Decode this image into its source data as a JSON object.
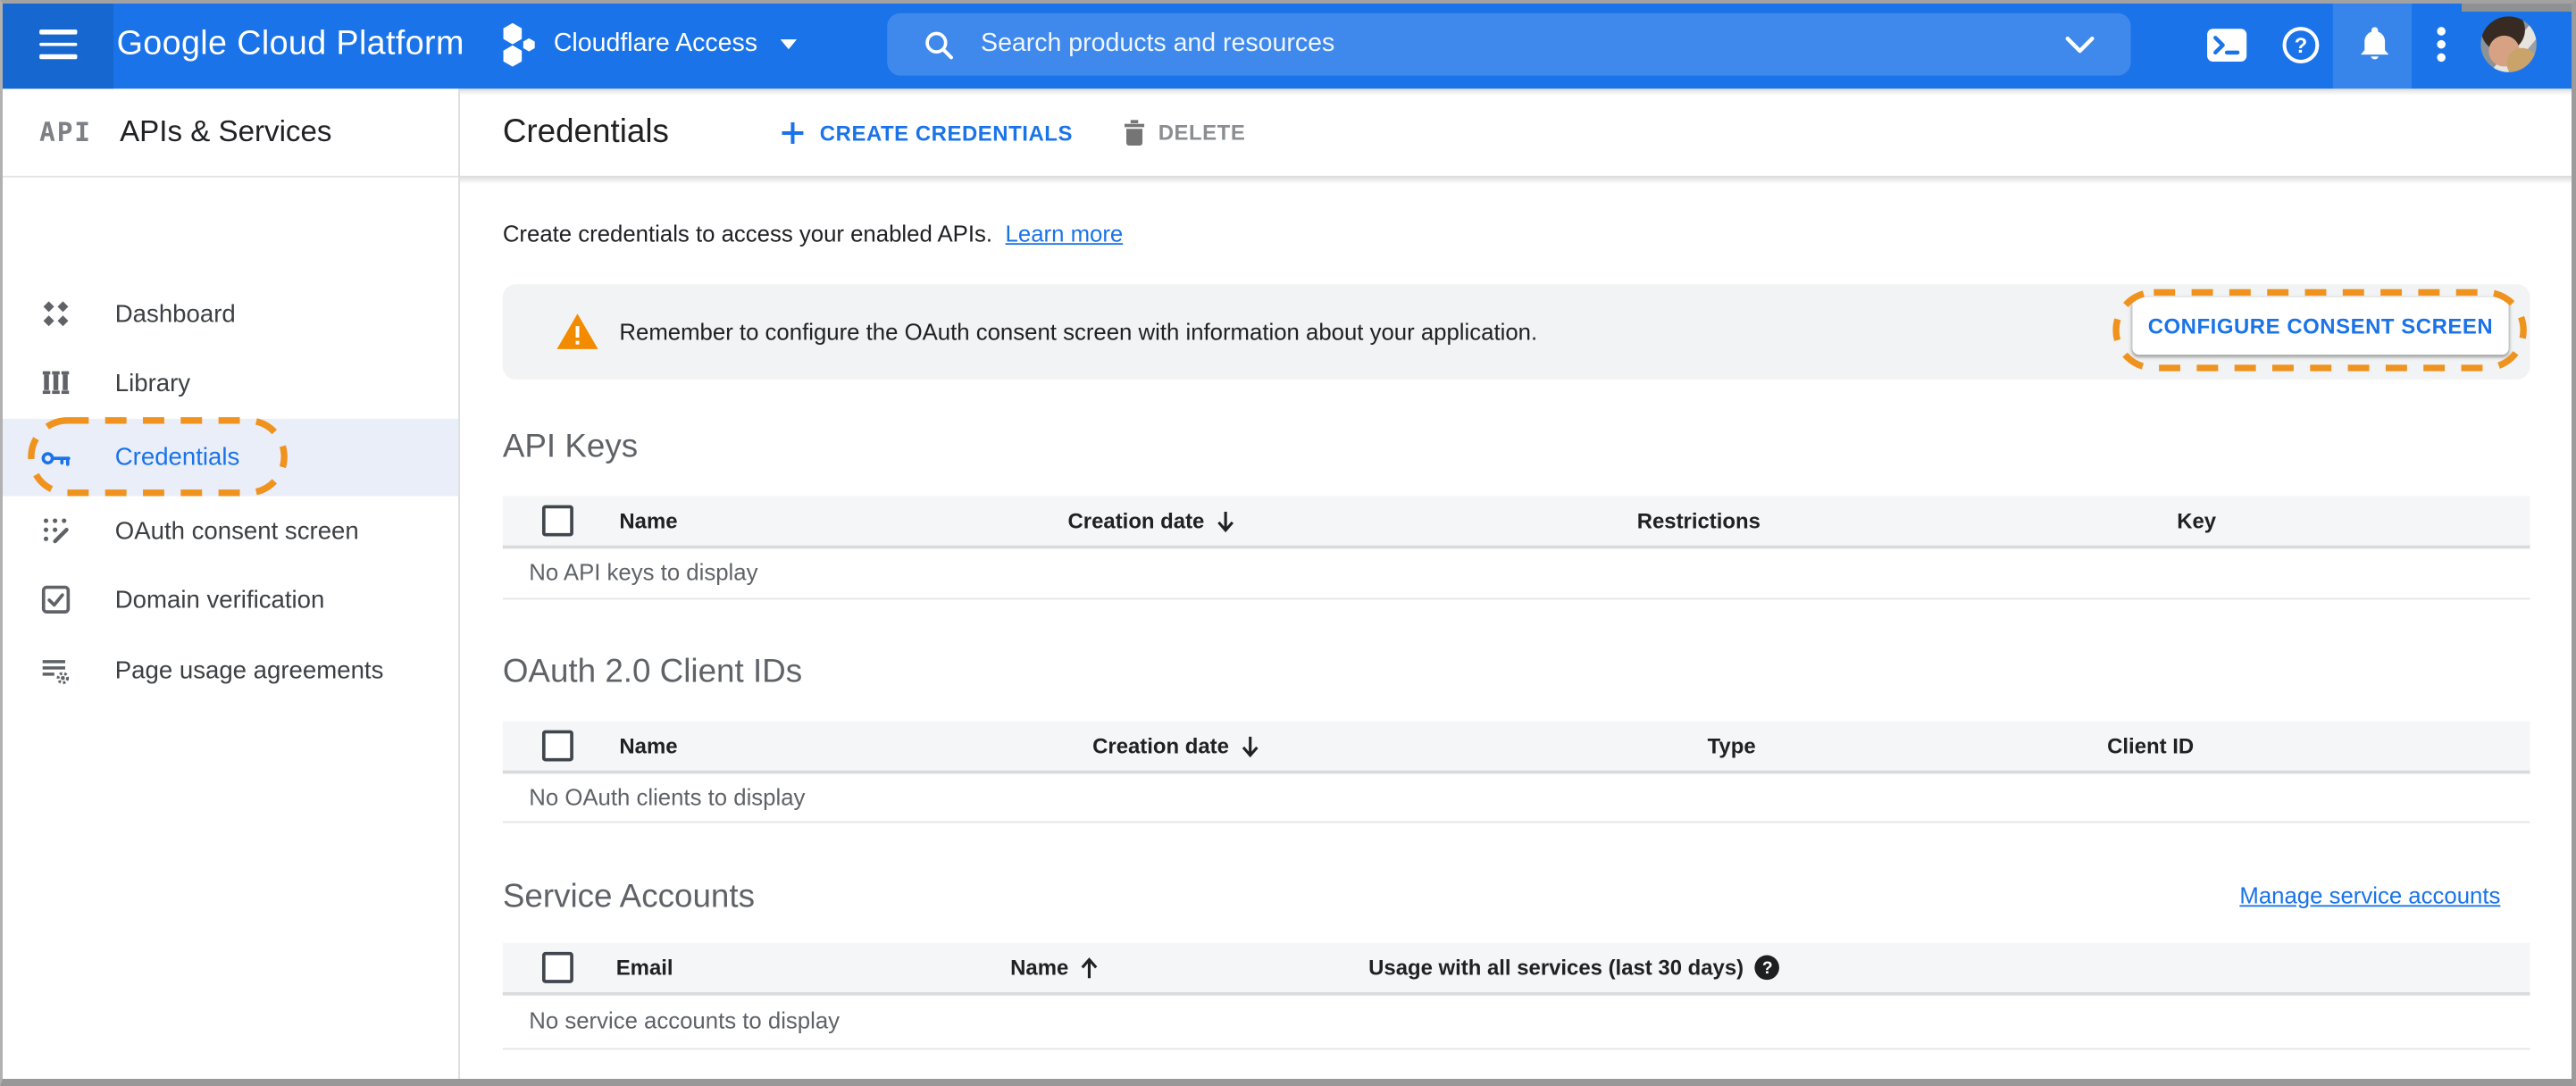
{
  "header": {
    "product_name": "Google Cloud Platform",
    "project": {
      "name": "Cloudflare Access",
      "icon": "hexagon-cluster-icon"
    },
    "search": {
      "placeholder": "Search products and resources",
      "icon": "search-icon",
      "dropdown_icon": "chevron-down-icon"
    },
    "action_icons": [
      "menu-icon",
      "cloud-shell-icon",
      "help-icon",
      "notifications-icon",
      "more-vertical-icon",
      "avatar"
    ],
    "colors": {
      "bar": "#1a73e8",
      "bar_left_band": "#1667cf"
    }
  },
  "sidebar": {
    "logo_glyph": "API",
    "title": "APIs & Services",
    "items": [
      {
        "label": "Dashboard",
        "icon": "dashboard-icon",
        "selected": false
      },
      {
        "label": "Library",
        "icon": "library-icon",
        "selected": false
      },
      {
        "label": "Credentials",
        "icon": "key-icon",
        "selected": true,
        "annotated": true
      },
      {
        "label": "OAuth consent screen",
        "icon": "consent-screen-icon",
        "selected": false
      },
      {
        "label": "Domain verification",
        "icon": "domain-verification-icon",
        "selected": false
      },
      {
        "label": "Page usage agreements",
        "icon": "page-usage-icon",
        "selected": false
      }
    ]
  },
  "toolbar": {
    "title": "Credentials",
    "create_label": "CREATE CREDENTIALS",
    "delete_label": "DELETE"
  },
  "main": {
    "intro": {
      "text": "Create credentials to access your enabled APIs.",
      "link_label": "Learn more"
    },
    "banner": {
      "message": "Remember to configure the OAuth consent screen with information about your application.",
      "button_label": "CONFIGURE CONSENT SCREEN",
      "icon": "warning-triangle-icon",
      "annotated": true
    },
    "sections": [
      {
        "title": "API Keys",
        "columns": [
          "Name",
          "Creation date",
          "Restrictions",
          "Key"
        ],
        "sort": {
          "column": "Creation date",
          "direction": "desc"
        },
        "empty_text": "No API keys to display",
        "rows": []
      },
      {
        "title": "OAuth 2.0 Client IDs",
        "columns": [
          "Name",
          "Creation date",
          "Type",
          "Client ID"
        ],
        "sort": {
          "column": "Creation date",
          "direction": "desc"
        },
        "empty_text": "No OAuth clients to display",
        "rows": []
      },
      {
        "title": "Service Accounts",
        "link_label": "Manage service accounts",
        "columns": [
          "Email",
          "Name",
          "Usage with all services (last 30 days)"
        ],
        "sort": {
          "column": "Name",
          "direction": "asc"
        },
        "help_icon": "help-filled-icon",
        "empty_text": "No service accounts to display",
        "rows": []
      }
    ]
  },
  "colors": {
    "accent_blue": "#1a73e8",
    "annotation_orange": "#F0931E",
    "warning_orange": "#F28B00",
    "banner_bg": "#F1F3F4",
    "selected_item_bg": "#E9EEF9"
  }
}
